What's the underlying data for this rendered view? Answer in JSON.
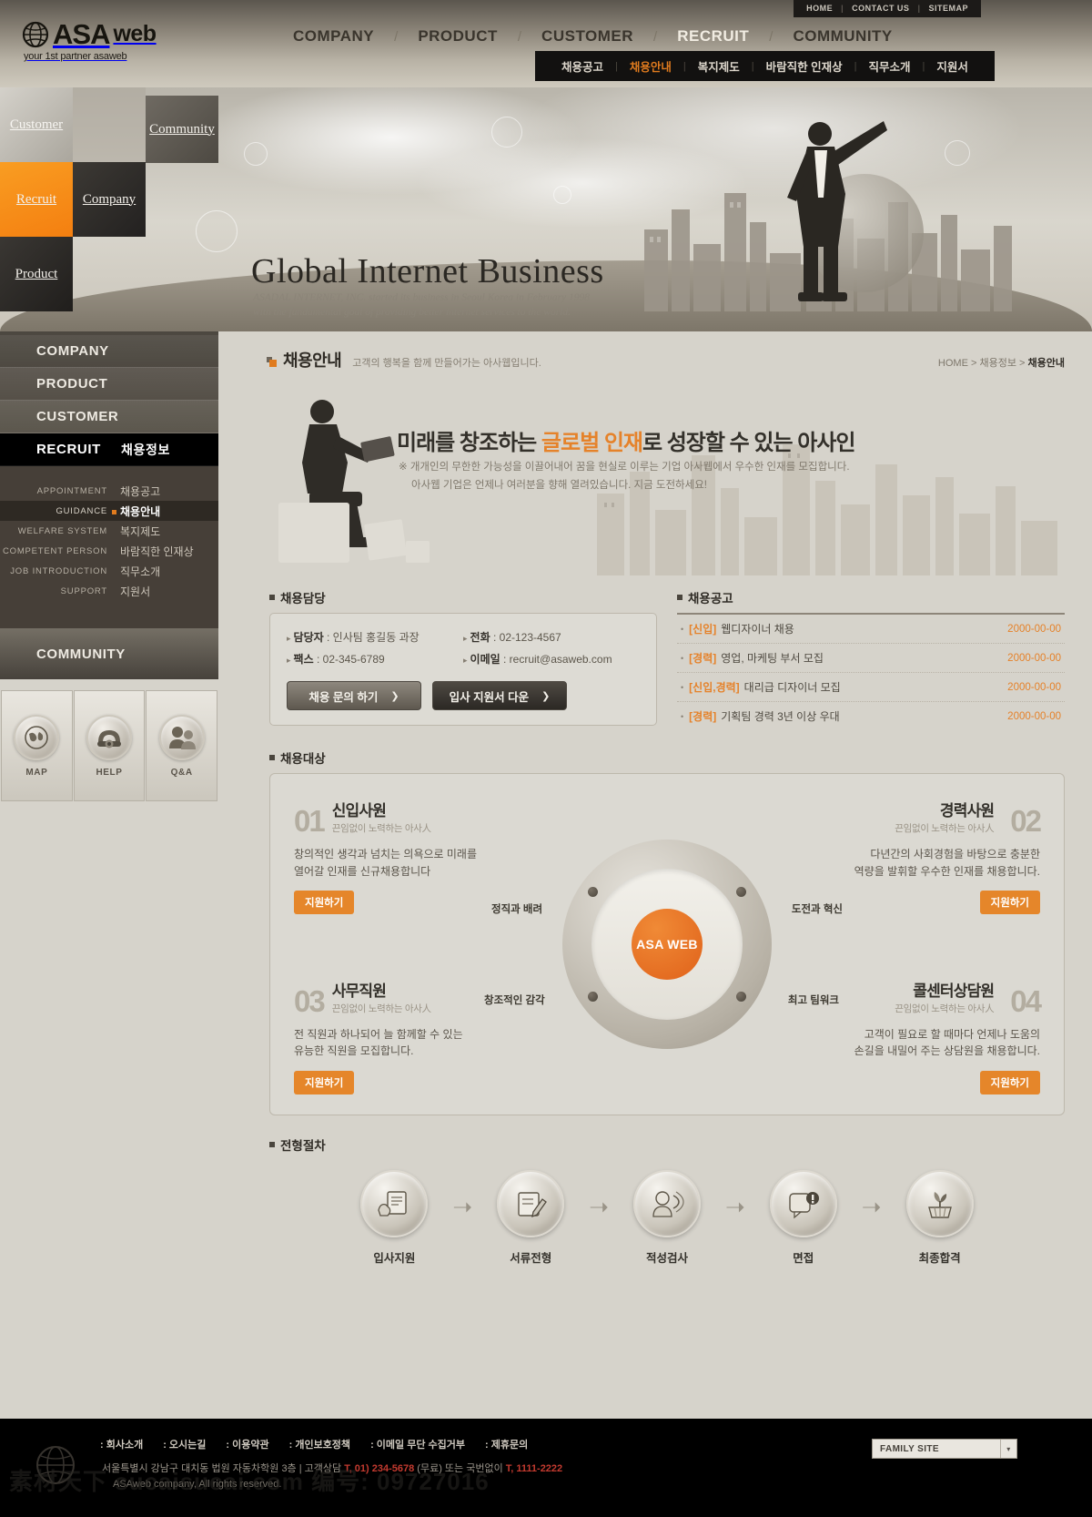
{
  "header": {
    "logo": {
      "brand_primary": "ASA",
      "brand_secondary": "web",
      "tagline": "your 1st partner asaweb",
      "icon": "globe-icon"
    },
    "utility": [
      {
        "label": "HOME"
      },
      {
        "label": "CONTACT US"
      },
      {
        "label": "SITEMAP"
      }
    ],
    "gnb": [
      {
        "label": "COMPANY",
        "active": false
      },
      {
        "label": "PRODUCT",
        "active": false
      },
      {
        "label": "CUSTOMER",
        "active": false
      },
      {
        "label": "RECRUIT",
        "active": true
      },
      {
        "label": "COMMUNITY",
        "active": false
      }
    ],
    "subnav": [
      {
        "label": "채용공고",
        "active": false
      },
      {
        "label": "채용안내",
        "active": true
      },
      {
        "label": "복지제도",
        "active": false
      },
      {
        "label": "바람직한 인재상",
        "active": false
      },
      {
        "label": "직무소개",
        "active": false
      },
      {
        "label": "지원서",
        "active": false
      }
    ]
  },
  "hero": {
    "title": "Global Internet Business",
    "desc_line1": "ASADAL INTERNET, INC. started its business in Seoul Korea in February 1998",
    "desc_line2": "with the fundamental goal of providing better internet services to the world.",
    "tiles": [
      {
        "label": "Customer"
      },
      {
        "label": "Community"
      },
      {
        "label": "Recruit"
      },
      {
        "label": "Company"
      },
      {
        "label": "Product"
      }
    ]
  },
  "sidebar": {
    "main_menu": [
      {
        "label": "COMPANY",
        "active": false,
        "kr": ""
      },
      {
        "label": "PRODUCT",
        "active": false,
        "kr": ""
      },
      {
        "label": "CUSTOMER",
        "active": false,
        "kr": ""
      },
      {
        "label": "RECRUIT",
        "active": true,
        "kr": "채용정보"
      }
    ],
    "sub_menu": [
      {
        "en": "APPOINTMENT",
        "kr": "채용공고",
        "active": false
      },
      {
        "en": "GUIDANCE",
        "kr": "채용안내",
        "active": true
      },
      {
        "en": "WELFARE SYSTEM",
        "kr": "복지제도",
        "active": false
      },
      {
        "en": "COMPETENT PERSON",
        "kr": "바람직한 인재상",
        "active": false
      },
      {
        "en": "JOB INTRODUCTION",
        "kr": "직무소개",
        "active": false
      },
      {
        "en": "SUPPORT",
        "kr": "지원서",
        "active": false
      }
    ],
    "community_label": "COMMUNITY",
    "quick": [
      {
        "label": "MAP",
        "icon": "globe-map-icon"
      },
      {
        "label": "HELP",
        "icon": "telephone-icon"
      },
      {
        "label": "Q&A",
        "icon": "people-icon"
      }
    ]
  },
  "page": {
    "title": "채용안내",
    "slogan": "고객의 행복을 함께 만들어가는 아사웹입니다.",
    "breadcrumb": {
      "home": "HOME",
      "sep": ">",
      "parent": "채용정보",
      "current": "채용안내"
    }
  },
  "visual": {
    "heading_pre": "미래를 창조하는 ",
    "heading_hl": "글로벌 인재",
    "heading_post": "로 성장할 수 있는 아사인",
    "line1": "※ 개개인의 무한한 가능성을 이끌어내어 꿈을 현실로 이루는 기업 아사웹에서 우수한 인재를 모집합니다.",
    "line2": "아사웹 기업은 언제나 여러분을 향해 열려있습니다. 지금 도전하세요!"
  },
  "contact": {
    "section_title": "채용담당",
    "fields": [
      {
        "label": "담당자",
        "value": "인사팀 홍길동 과장"
      },
      {
        "label": "전화",
        "value": "02-123-4567"
      },
      {
        "label": "팩스",
        "value": "02-345-6789"
      },
      {
        "label": "이메일",
        "value": "recruit@asaweb.com"
      }
    ],
    "buttons": [
      {
        "label": "채용 문의 하기",
        "arrow": "❯"
      },
      {
        "label": "입사 지원서 다운",
        "arrow": "❯"
      }
    ]
  },
  "notice": {
    "section_title": "채용공고",
    "rows": [
      {
        "tag": "[신입]",
        "text": "웹디자이너 채용",
        "date": "2000-00-00"
      },
      {
        "tag": "[경력]",
        "text": "영업, 마케팅 부서 모집",
        "date": "2000-00-00"
      },
      {
        "tag": "[신입,경력]",
        "text": "대리급 디자이너 모집",
        "date": "2000-00-00"
      },
      {
        "tag": "[경력]",
        "text": "기획팀 경력 3년 이상 우대",
        "date": "2000-00-00"
      }
    ]
  },
  "target": {
    "section_title": "채용대상",
    "quadrants": [
      {
        "num": "01",
        "name": "신입사원",
        "slogan": "끈임없이 노력하는 아사人",
        "desc_line1": "창의적인 생각과 넘치는 의욕으로 미래를",
        "desc_line2": "열어갈 인재를 신규채용합니다",
        "button": "지원하기"
      },
      {
        "num": "02",
        "name": "경력사원",
        "slogan": "끈임없이 노력하는 아사人",
        "desc_line1": "다년간의 사회경험을 바탕으로 충분한",
        "desc_line2": "역량을 발휘할 우수한 인재를 채용합니다.",
        "button": "지원하기"
      },
      {
        "num": "03",
        "name": "사무직원",
        "slogan": "끈임없이 노력하는 아사人",
        "desc_line1": "전 직원과 하나되어 늘 함께할 수 있는",
        "desc_line2": "유능한 직원을 모집합니다.",
        "button": "지원하기"
      },
      {
        "num": "04",
        "name": "콜센터상담원",
        "slogan": "끈임없이 노력하는 아사人",
        "desc_line1": "고객이 필요로 할 때마다 언제나 도움의",
        "desc_line2": "손길을 내밀어 주는 상담원을 채용합니다.",
        "button": "지원하기"
      }
    ],
    "core_label": "ASA WEB",
    "nodes": [
      {
        "label": "정직과 배려"
      },
      {
        "label": "도전과 혁신"
      },
      {
        "label": "창조적인 감각"
      },
      {
        "label": "최고 팀워크"
      }
    ]
  },
  "process": {
    "section_title": "전형절차",
    "steps": [
      {
        "label": "입사지원",
        "icon": "hand-document-icon"
      },
      {
        "label": "서류전형",
        "icon": "clipboard-pen-icon"
      },
      {
        "label": "적성검사",
        "icon": "speaking-person-icon"
      },
      {
        "label": "면접",
        "icon": "interview-alert-icon"
      },
      {
        "label": "최종합격",
        "icon": "sprout-basket-icon"
      }
    ],
    "arrow": "➝"
  },
  "footer": {
    "links": [
      {
        "label": ": 회사소개"
      },
      {
        "label": ": 오시는길"
      },
      {
        "label": ": 이용약관"
      },
      {
        "label": ": 개인보호정책"
      },
      {
        "label": ": 이메일 무단 수집거부"
      },
      {
        "label": ": 제휴문의"
      }
    ],
    "address_pre": "서울특별시 강남구 대치동 법원 자동차학원 3층 | 고객상담 ",
    "address_tel1": "T, 01) 234-5678",
    "address_mid": " (무료) 또는 국번없이 ",
    "address_tel2": "T, 1111-2222",
    "copyright": "ASAweb company, All rights reserved.",
    "family_site": "FAMILY SITE",
    "chevron": "▾"
  },
  "watermark": "素材天下 sucaisucai.com 编号: 09727016"
}
